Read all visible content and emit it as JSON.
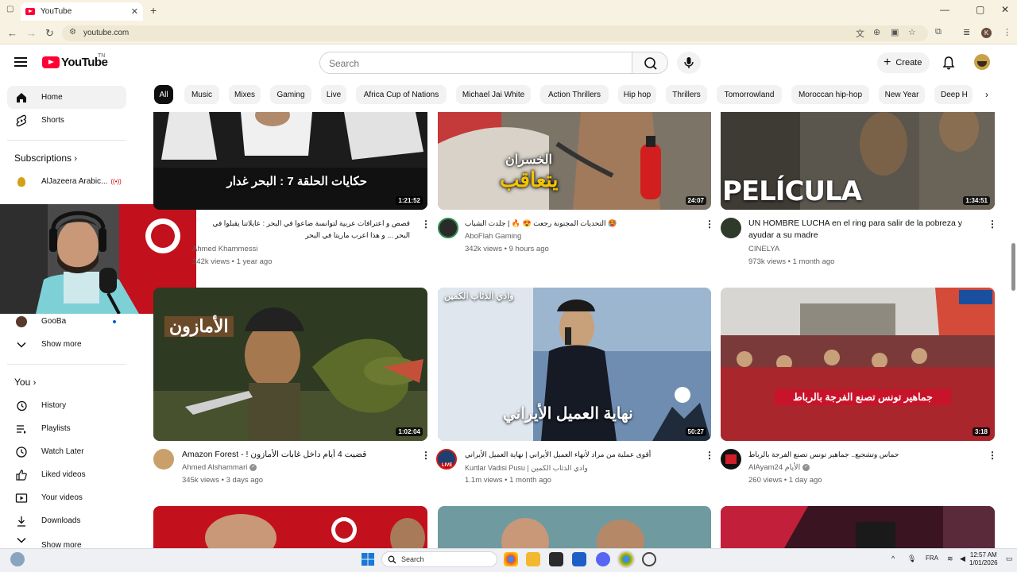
{
  "browser": {
    "tab_title": "YouTube",
    "tab_close": "✕",
    "new_tab": "+",
    "url": "youtube.com",
    "window_controls": [
      "—",
      "▢",
      "✕"
    ],
    "profile_initial": "K"
  },
  "header": {
    "logo_text": "YouTube",
    "logo_tn": "TN",
    "search_placeholder": "Search",
    "create_label": "Create",
    "create_plus": "+"
  },
  "sidebar": {
    "primary": [
      {
        "label": "Home",
        "icon": "home-icon"
      },
      {
        "label": "Shorts",
        "icon": "shorts-icon"
      }
    ],
    "subscriptions_heading": "Subscriptions",
    "subscriptions": [
      {
        "label": "AlJazeera Arabic...",
        "live": "((•))",
        "color": "#d4a017"
      },
      {
        "label": "GooBa",
        "color": "#5a3a2a"
      }
    ],
    "show_more": "Show more",
    "you_heading": "You",
    "you_items": [
      {
        "label": "History",
        "icon": "history-icon"
      },
      {
        "label": "Playlists",
        "icon": "playlists-icon"
      },
      {
        "label": "Watch Later",
        "icon": "watch-later-icon"
      },
      {
        "label": "Liked videos",
        "icon": "like-icon"
      },
      {
        "label": "Your videos",
        "icon": "your-videos-icon"
      },
      {
        "label": "Downloads",
        "icon": "download-icon"
      },
      {
        "label": "Show more",
        "icon": "chevron-down-icon"
      }
    ]
  },
  "chips": [
    "All",
    "Music",
    "Mixes",
    "Gaming",
    "Live",
    "Africa Cup of Nations",
    "Michael Jai White",
    "Action Thrillers",
    "Hip hop",
    "Thrillers",
    "Tomorrowland",
    "Moroccan hip-hop",
    "New Year",
    "Deep H"
  ],
  "videos": [
    {
      "duration": "1:21:52",
      "caption": "حكايات الحلقة 7 : البحر غدار",
      "title": "قصص و اعترافات عربية لتوانسة ضاعوا في البحر : عايلاتنا يقبلوا في البحر ... و هذا اعرب ماريتا في البحر",
      "channel": "Ahmed Khammessi",
      "views": "342k views",
      "age": "1 year ago",
      "thumb_bg": "#2b2b2b"
    },
    {
      "duration": "24:07",
      "caption": "يتعاقب",
      "caption2": "الخسران",
      "title": "التحديات المجنونة رجعت 😍 🔥 | جلدت الشباب 🥵",
      "channel": "AboFlah Gaming",
      "views": "342k views",
      "age": "9 hours ago",
      "thumb_bg": "#8a7a6a"
    },
    {
      "duration": "1:34:51",
      "caption": "PELÍCULA",
      "title": "UN HOMBRE LUCHA en el ring para salir de la pobreza y ayudar a su madre",
      "channel": "CINELYA",
      "views": "973k views",
      "age": "1 month ago",
      "thumb_bg": "#5a564e"
    },
    {
      "duration": "1:02:04",
      "caption": "الأمازون",
      "title": "Amazon Forest - ! قضيت 4 أيام داخل غابات الأمازون",
      "channel": "Ahmed Alshammari",
      "views": "345k views",
      "age": "3 days ago",
      "thumb_bg": "#3e4a2c"
    },
    {
      "duration": "50:27",
      "caption": "نهاية العميل الأيراني",
      "caption_top": "وادي الذئاب الكمين",
      "title": "أقوى عملية من مراد لأنهاء العميل الأيراني | نهاية العميل الأيراني",
      "channel": "Kurtlar Vadisi Pusu | وادي الذئاب الكمين",
      "views": "1.1m views",
      "age": "1 month ago",
      "thumb_bg": "#4b6a8f"
    },
    {
      "duration": "3:18",
      "caption": "جماهير تونس تصنع الفرجة بالرباط",
      "title": "حماس وتشجيع.. جماهير تونس تصنع الفرجة بالرباط",
      "channel": "AlAyam24 الأيام",
      "views": "260 views",
      "age": "1 day ago",
      "thumb_bg": "#b8b4ae"
    }
  ],
  "taskbar": {
    "search": "Search",
    "lang": "FRA",
    "time": "12:57 AM",
    "date": "1/01/2026"
  }
}
